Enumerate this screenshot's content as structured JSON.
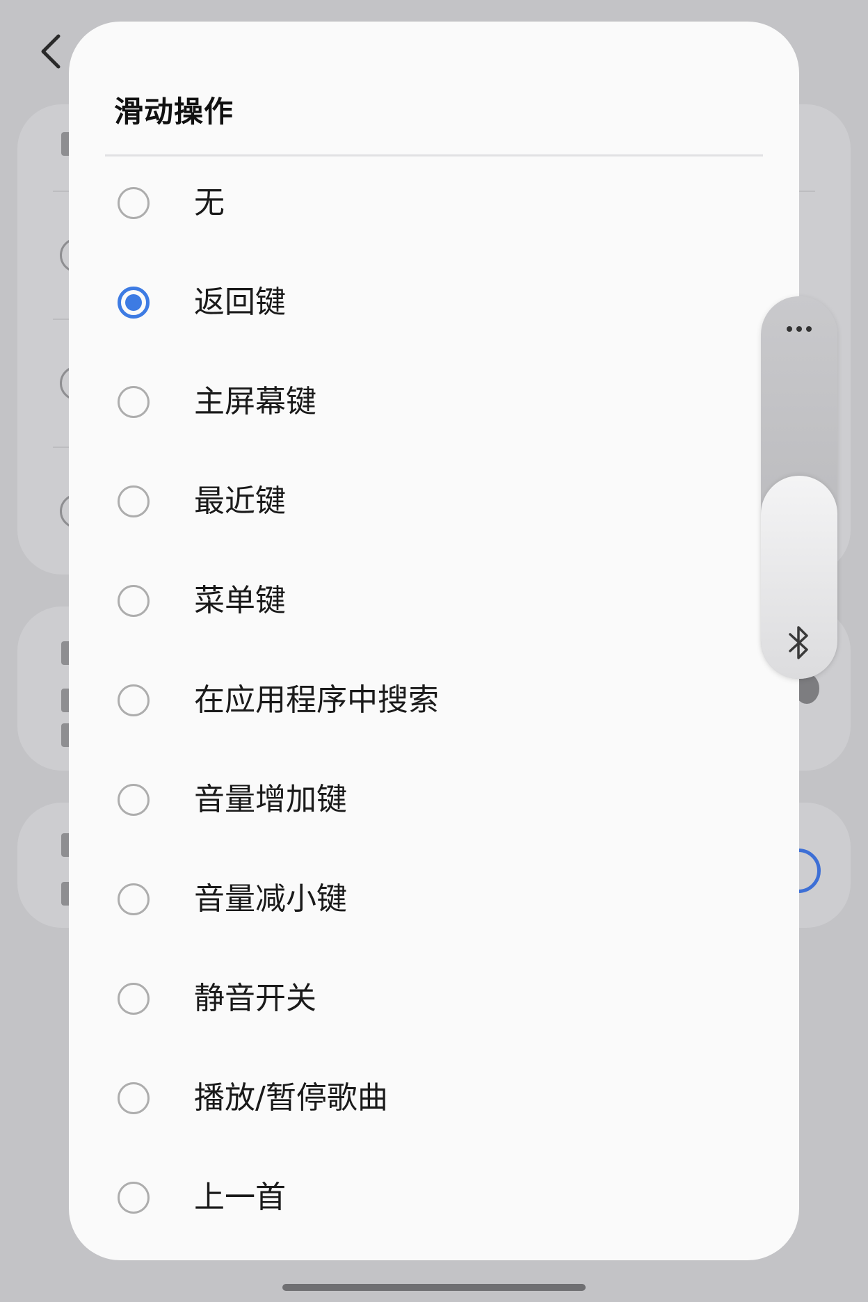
{
  "dialog": {
    "title": "滑动操作",
    "selected_index": 1,
    "options": [
      {
        "label": "无",
        "checked": false
      },
      {
        "label": "返回键",
        "checked": true
      },
      {
        "label": "主屏幕键",
        "checked": false
      },
      {
        "label": "最近键",
        "checked": false
      },
      {
        "label": "菜单键",
        "checked": false
      },
      {
        "label": "在应用程序中搜索",
        "checked": false
      },
      {
        "label": "音量增加键",
        "checked": false
      },
      {
        "label": "音量减小键",
        "checked": false
      },
      {
        "label": "静音开关",
        "checked": false
      },
      {
        "label": "播放/暂停歌曲",
        "checked": false
      },
      {
        "label": "上一首",
        "checked": false
      }
    ]
  },
  "edge_panel": {
    "top_icon": "more-dots-icon",
    "bottom_icon": "bluetooth-icon"
  },
  "colors": {
    "accent": "#3d7be3",
    "scrim": "#c3c3c6",
    "dialog_bg": "#fafafa"
  }
}
